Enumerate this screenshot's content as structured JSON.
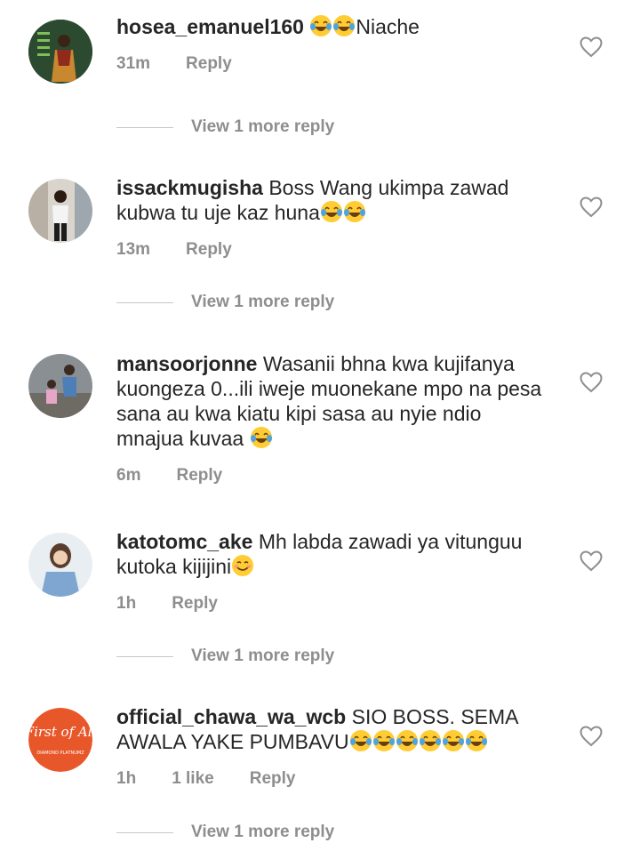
{
  "comments": [
    {
      "username": "hosea_emanuel160",
      "text_parts": [
        "",
        "😂",
        "😂",
        "Niache"
      ],
      "time": "31m",
      "likes": "",
      "reply_label": "Reply",
      "view_more": "View 1 more reply"
    },
    {
      "username": "issackmugisha",
      "text_parts": [
        "Boss Wang ukimpa zawad kubwa tu uje kaz huna",
        "😂",
        "😂"
      ],
      "time": "13m",
      "likes": "",
      "reply_label": "Reply",
      "view_more": "View 1 more reply"
    },
    {
      "username": "mansoorjonne",
      "text_parts": [
        "Wasanii bhna kwa kujifanya kuongeza 0...ili iweje muonekane mpo  na pesa sana au kwa kiatu kipi sasa au nyie ndio mnajua kuvaa ",
        "😂"
      ],
      "time": "6m",
      "likes": "",
      "reply_label": "Reply",
      "view_more": ""
    },
    {
      "username": "katotomc_ake",
      "text_parts": [
        "Mh labda zawadi ya vitunguu kutoka kijijini",
        "😊"
      ],
      "time": "1h",
      "likes": "",
      "reply_label": "Reply",
      "view_more": "View 1 more reply"
    },
    {
      "username": "official_chawa_wa_wcb",
      "text_parts": [
        "SIO BOSS. SEMA AWALA YAKE PUMBAVU",
        "😂",
        "😂",
        "😂",
        "😂",
        "😂",
        "😂"
      ],
      "time": "1h",
      "likes": "1 like",
      "reply_label": "Reply",
      "view_more": "View 1 more reply"
    }
  ],
  "avatars": {
    "chawa_avatar_text": "First of All",
    "chawa_avatar_subtext": "DIAMOND PLATNUMZ"
  },
  "colors": {
    "text": "#262626",
    "meta": "#8e8e8e",
    "divider": "#c7c7c7",
    "chawa_avatar_bg": "#e8572a"
  },
  "icons": {
    "like": "heart-outline-icon",
    "laugh": "face-with-tears-of-joy-emoji",
    "smile": "smiling-face-emoji"
  }
}
